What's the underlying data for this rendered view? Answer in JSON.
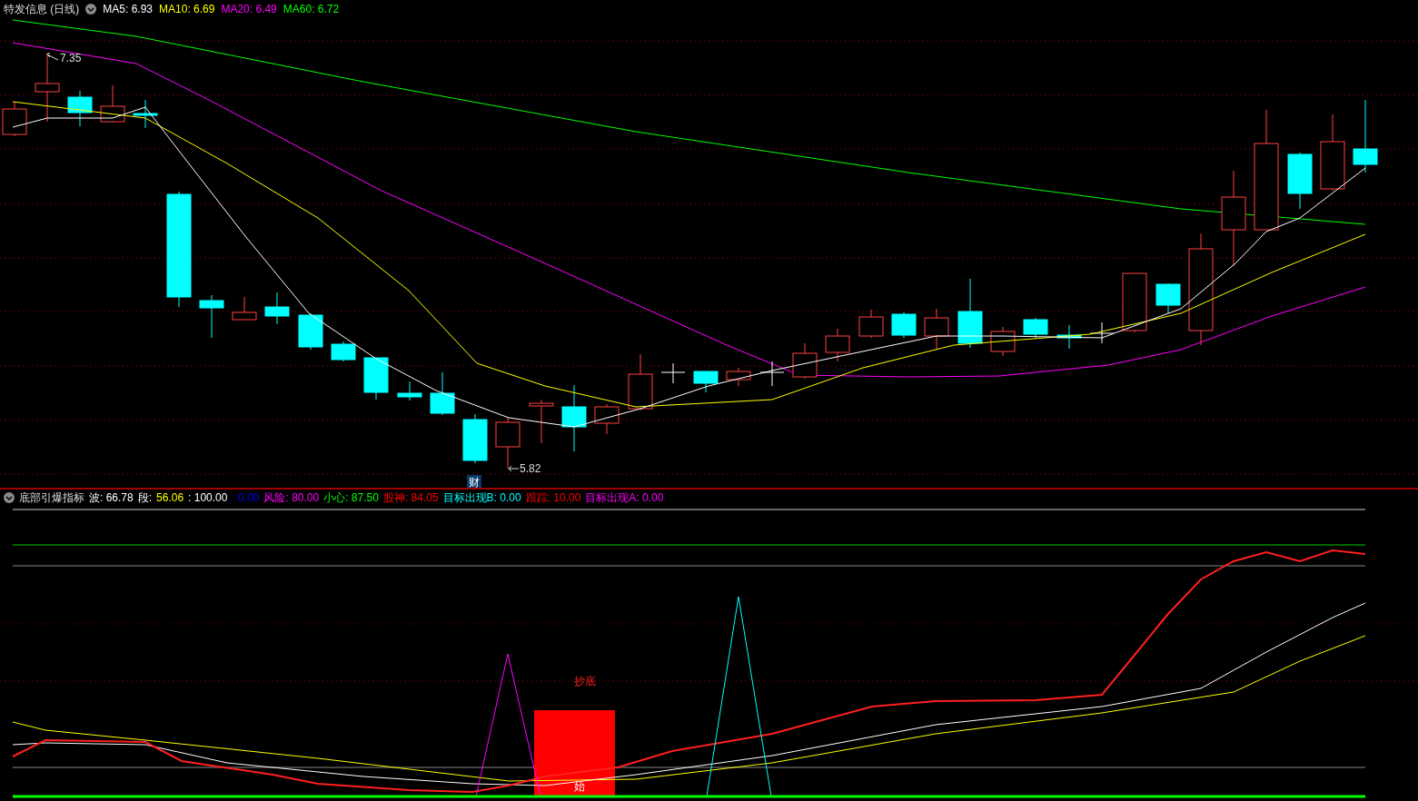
{
  "main_chart": {
    "title": "特发信息 (日线)",
    "indicators": [
      {
        "text": "MA5: 6.93",
        "color": "#ffffff"
      },
      {
        "text": "MA10: 6.69",
        "color": "#ffff00"
      },
      {
        "text": "MA20: 6.49",
        "color": "#ff00ff"
      },
      {
        "text": "MA60: 6.72",
        "color": "#00ff00"
      }
    ],
    "high_label": "7.35",
    "low_label": "5.82",
    "badge": "财"
  },
  "sub_chart": {
    "title": "底部引爆指标",
    "indicators": [
      {
        "text": "波: 66.78",
        "color": "#ffffff"
      },
      {
        "text": "段:",
        "color": "#ffffff"
      },
      {
        "text": "56.06",
        "color": "#ffff00"
      },
      {
        "text": ": 100.00",
        "color": "#ffffff"
      },
      {
        "text": ": 0.00",
        "color": "#0000ff"
      },
      {
        "text": "风险: 80.00",
        "color": "#ff00ff"
      },
      {
        "text": "小心: 87.50",
        "color": "#00ff00"
      },
      {
        "text": "股神: 84.05",
        "color": "#ff0000"
      },
      {
        "text": "目标出现B: 0.00",
        "color": "#00ffff"
      },
      {
        "text": "跟踪: 10.00",
        "color": "#ff0000"
      },
      {
        "text": "目标出现A: 0.00",
        "color": "#ff00ff"
      }
    ],
    "signal_label": "抄底",
    "start_label": "始"
  }
}
